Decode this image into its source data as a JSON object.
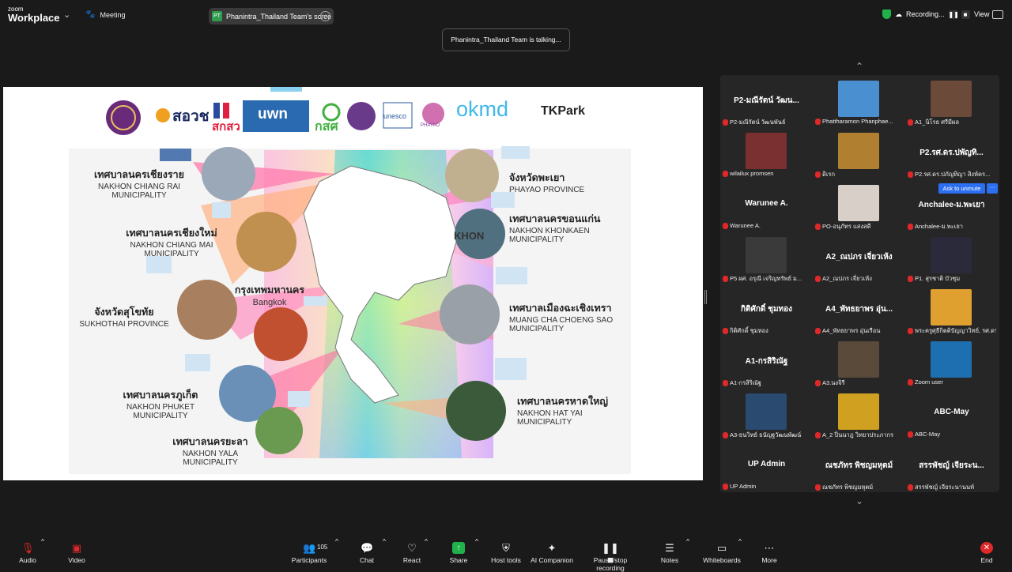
{
  "topbar": {
    "logo_line1": "zoom",
    "logo_line2": "Workplace",
    "meeting_label": "Meeting",
    "share_badge": "PT",
    "share_label": "Phanintra_Thailand Team's scree",
    "recording_label": "Recording...",
    "view_label": "View"
  },
  "talking_toast": "Phanintra_Thailand Team is talking...",
  "slide": {
    "logos": [
      "สอวช",
      "สกสว",
      "uwn",
      "กสศ",
      "unesco",
      "PHAYAO",
      "okmd",
      "TKPark"
    ],
    "cities": [
      {
        "th": "เทศบาลนครเชียงราย",
        "en": "NAKHON CHIANG RAI",
        "en2": "MUNICIPALITY"
      },
      {
        "th": "เทศบาลนครเชียงใหม่",
        "en": "NAKHON CHIANG MAI",
        "en2": "MUNICIPALITY"
      },
      {
        "th": "จังหวัดสุโขทัย",
        "en": "SUKHOTHAI PROVINCE",
        "en2": ""
      },
      {
        "th": "กรุงเทพมหานคร",
        "en": "Bangkok",
        "en2": ""
      },
      {
        "th": "เทศบาลนครภูเก็ต",
        "en": "NAKHON PHUKET",
        "en2": "MUNICIPALITY"
      },
      {
        "th": "เทศบาลนครยะลา",
        "en": "NAKHON YALA",
        "en2": "MUNICIPALITY"
      },
      {
        "th": "จังหวัดพะเยา",
        "en": "PHAYAO PROVINCE",
        "en2": ""
      },
      {
        "th": "เทศบาลนครขอนแก่น",
        "en": "NAKHON KHONKAEN",
        "en2": "MUNICIPALITY"
      },
      {
        "th": "เทศบาลเมืองฉะเชิงเทรา",
        "en": "MUANG CHA CHOENG SAO",
        "en2": "MUNICIPALITY"
      },
      {
        "th": "เทศบาลนครหาดใหญ่",
        "en": "NAKHON HAT YAI",
        "en2": "MUNICIPALITY"
      }
    ],
    "khon_label": "KHON"
  },
  "participants": [
    {
      "big": "P2-มณีรัตน์ วัฒน...",
      "name": "P2-มณีรัตน์ วัฒนพันธ์",
      "video": false
    },
    {
      "big": "",
      "name": "Phattharamon Phanphae...",
      "video": true,
      "color": "#4a8fd0"
    },
    {
      "big": "",
      "name": "A1_นิโรธ ศรีมีผล",
      "video": true,
      "color": "#6b4a3a"
    },
    {
      "big": "",
      "name": "wilailux promsen",
      "video": true,
      "color": "#7a3030"
    },
    {
      "big": "",
      "name": "ดิเรก",
      "video": true,
      "color": "#b08030"
    },
    {
      "big": "P2.รศ.ดร.ปพัญทิ...",
      "name": "P2.รศ.ดร.ปภัญทิญา สิงห์คร...",
      "video": false
    },
    {
      "big": "Warunee A.",
      "name": "Warunee A.",
      "video": false
    },
    {
      "big": "",
      "name": "PO-อนุภัทร แสงสดี",
      "video": true,
      "color": "#d8d0c8"
    },
    {
      "big": "Anchalee-ม.พะเยา",
      "name": "Anchalee-ม.พะเยา",
      "video": false
    },
    {
      "big": "",
      "name": "P5 ผศ. อรุณี เจริญทรัพย์ ม...",
      "video": true,
      "color": "#3a3a3a"
    },
    {
      "big": "A2_ณปภร เจี่ยวเห้ง",
      "name": "A2_ณปภร เจี่ยวเห้ง",
      "video": false
    },
    {
      "big": "",
      "name": "P1. สุรชาติ บัวชุม",
      "video": true,
      "color": "#2a2a3a"
    },
    {
      "big": "กิติศักดิ์ ชุมทอง",
      "name": "กิติศักดิ์ ชุมทอง",
      "video": false
    },
    {
      "big": "A4_พัทธยาพร อุ่น...",
      "name": "A4_พัทธยาพร อุ่นเรือน",
      "video": false
    },
    {
      "big": "",
      "name": "พระครูศุธีกิตติปัญญาวิทย์, รศ.ดร.",
      "video": true,
      "color": "#e0a030"
    },
    {
      "big": "A1-กรสิริณัฐ",
      "name": "A1-กรสิริณัฐ",
      "video": false
    },
    {
      "big": "",
      "name": "A3.นงจิรี",
      "video": true,
      "color": "#5a4a3a"
    },
    {
      "big": "",
      "name": "Zoom user",
      "video": true,
      "color": "#1e6fb0"
    },
    {
      "big": "",
      "name": "A3-ธนวิทย์ ธนัญฐวัฒนพัฒน์",
      "video": true,
      "color": "#2a4a70"
    },
    {
      "big": "",
      "name": "A_2 ปิ่นนาฎ วิทยาประภากร",
      "video": true,
      "color": "#d0a020"
    },
    {
      "big": "ABC-May",
      "name": "ABC-May",
      "video": false
    },
    {
      "big": "UP Admin",
      "name": "UP Admin",
      "video": false
    },
    {
      "big": "ณชภัทร พิชญมหุตม์",
      "name": "ณชภัทร พิชญมหุตม์",
      "video": false
    },
    {
      "big": "สรรพัชญ์ เจียระน...",
      "name": "สรรพัชญ์ เจียระนานนท์",
      "video": false
    }
  ],
  "ask_unmute": "Ask to unmute",
  "ask_more": "···",
  "toolbar": {
    "audio": "Audio",
    "video": "Video",
    "participants": "Participants",
    "participants_count": "105",
    "chat": "Chat",
    "react": "React",
    "share": "Share",
    "host_tools": "Host tools",
    "ai_companion": "AI Companion",
    "pause_recording": "Pause/stop recording",
    "notes": "Notes",
    "whiteboards": "Whiteboards",
    "more": "More",
    "end": "End"
  }
}
